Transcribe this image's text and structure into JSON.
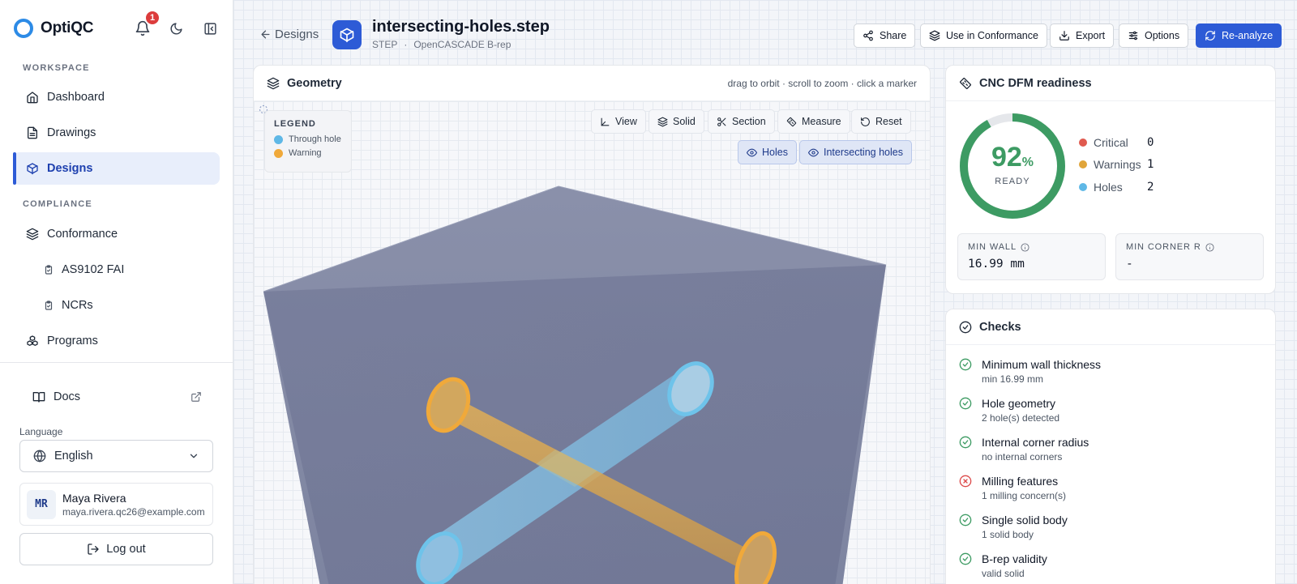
{
  "app": {
    "name": "OptiQC",
    "notification_count": "1"
  },
  "sidebar": {
    "sections": [
      {
        "label": "WORKSPACE"
      },
      {
        "label": "COMPLIANCE"
      }
    ],
    "items": [
      {
        "label": "Dashboard",
        "icon": "home-icon"
      },
      {
        "label": "Drawings",
        "icon": "file-icon"
      },
      {
        "label": "Designs",
        "icon": "cube-icon",
        "active": true
      },
      {
        "label": "Conformance",
        "icon": "layers-icon"
      },
      {
        "label": "AS9102 FAI",
        "icon": "clipboard-icon"
      },
      {
        "label": "NCRs",
        "icon": "clipboard-icon"
      },
      {
        "label": "Programs",
        "icon": "boxes-icon"
      }
    ],
    "docs_label": "Docs",
    "language": {
      "label": "Language",
      "value": "English"
    },
    "user": {
      "initials": "MR",
      "name": "Maya Rivera",
      "email": "maya.rivera.qc26@example.com"
    },
    "logout_label": "Log out"
  },
  "header": {
    "back_label": "Designs",
    "file_name": "intersecting-holes.step",
    "format": "STEP",
    "kernel": "OpenCASCADE B-rep",
    "buttons": {
      "share": "Share",
      "use_in_conformance": "Use in Conformance",
      "export": "Export",
      "options": "Options",
      "reanalyze": "Re-analyze"
    }
  },
  "geometry": {
    "title": "Geometry",
    "hint": "drag to orbit · scroll to zoom · click a marker",
    "legend": {
      "title": "LEGEND",
      "items": [
        {
          "label": "Through hole",
          "color": "#5fb8e6"
        },
        {
          "label": "Warning",
          "color": "#f0a93a"
        }
      ]
    },
    "view_buttons": {
      "view": "View",
      "solid": "Solid",
      "section": "Section",
      "measure": "Measure",
      "reset": "Reset"
    },
    "toggles": {
      "holes": "Holes",
      "intersecting_holes": "Intersecting holes"
    }
  },
  "dfm": {
    "title": "CNC DFM readiness",
    "score": 92,
    "score_display": "92",
    "score_unit": "%",
    "status": "READY",
    "stats": [
      {
        "label": "Critical",
        "value": "0",
        "color": "#e05a4f"
      },
      {
        "label": "Warnings",
        "value": "1",
        "color": "#e0a53a"
      },
      {
        "label": "Holes",
        "value": "2",
        "color": "#5fb8e6"
      }
    ],
    "min_wall": {
      "label": "MIN WALL",
      "value": "16.99 mm"
    },
    "min_corner": {
      "label": "MIN CORNER R",
      "value": "-"
    }
  },
  "checks": {
    "title": "Checks",
    "items": [
      {
        "title": "Minimum wall thickness",
        "detail": "min 16.99 mm",
        "status": "pass"
      },
      {
        "title": "Hole geometry",
        "detail": "2 hole(s) detected",
        "status": "pass"
      },
      {
        "title": "Internal corner radius",
        "detail": "no internal corners",
        "status": "pass"
      },
      {
        "title": "Milling features",
        "detail": "1 milling concern(s)",
        "status": "fail"
      },
      {
        "title": "Single solid body",
        "detail": "1 solid body",
        "status": "pass"
      },
      {
        "title": "B-rep validity",
        "detail": "valid solid",
        "status": "pass"
      }
    ]
  },
  "colors": {
    "accent": "#2d5bd6",
    "success": "#3d9b63",
    "danger": "#dc4a4a",
    "hole_blue": "#5fb8e6",
    "warning_orange": "#f0a93a"
  }
}
